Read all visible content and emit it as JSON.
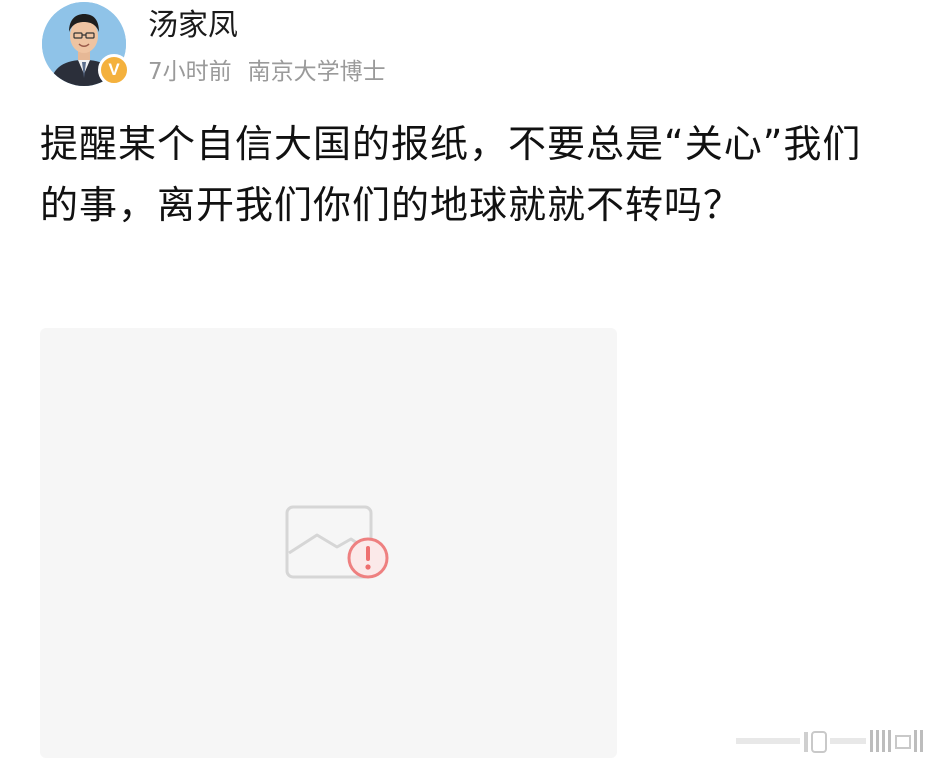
{
  "post": {
    "author": {
      "name": "汤家凤",
      "verified_badge": "V",
      "avatar_icon": "avatar-portrait-icon"
    },
    "time": "7小时前",
    "source": "南京大学博士",
    "text": "提醒某个自信大国的报纸，不要总是“关心”我们的事，离开我们你们的地球就就不转吗？",
    "image": {
      "status_icon": "broken-image-icon"
    }
  },
  "colors": {
    "badge": "#f4b13d",
    "meta_text": "#9a9a9a",
    "placeholder_bg": "#f6f6f6",
    "error_red": "#ee6f6f"
  }
}
